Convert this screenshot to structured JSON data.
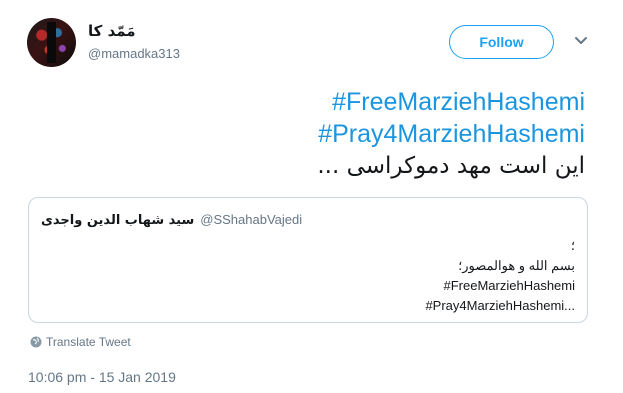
{
  "author": {
    "display_name": "مَمّد کا",
    "username": "@mamadka313"
  },
  "follow_button": {
    "label": "Follow"
  },
  "tweet": {
    "hashtag_1": "#FreeMarziehHashemi",
    "hashtag_2": "#Pray4MarziehHashemi",
    "text": "این است مهد دموکراسی ..."
  },
  "quoted_tweet": {
    "name": "سید شهاب الدین واجدی",
    "handle": "@SShahabVajedi",
    "lines": [
      "؛",
      "بسم الله و هوالمصور؛",
      "#FreeMarziehHashemi",
      "#Pray4MarziehHashemi..."
    ]
  },
  "translate_label": "Translate Tweet",
  "timestamp": "10:06 pm - 15 Jan 2019",
  "colors": {
    "accent": "#1da1f2",
    "hashtag": "#1b95e0",
    "muted": "#657786",
    "border": "#ccd6dd"
  },
  "icons": {
    "menu": "chevron-down-icon",
    "translate": "globe-icon"
  }
}
